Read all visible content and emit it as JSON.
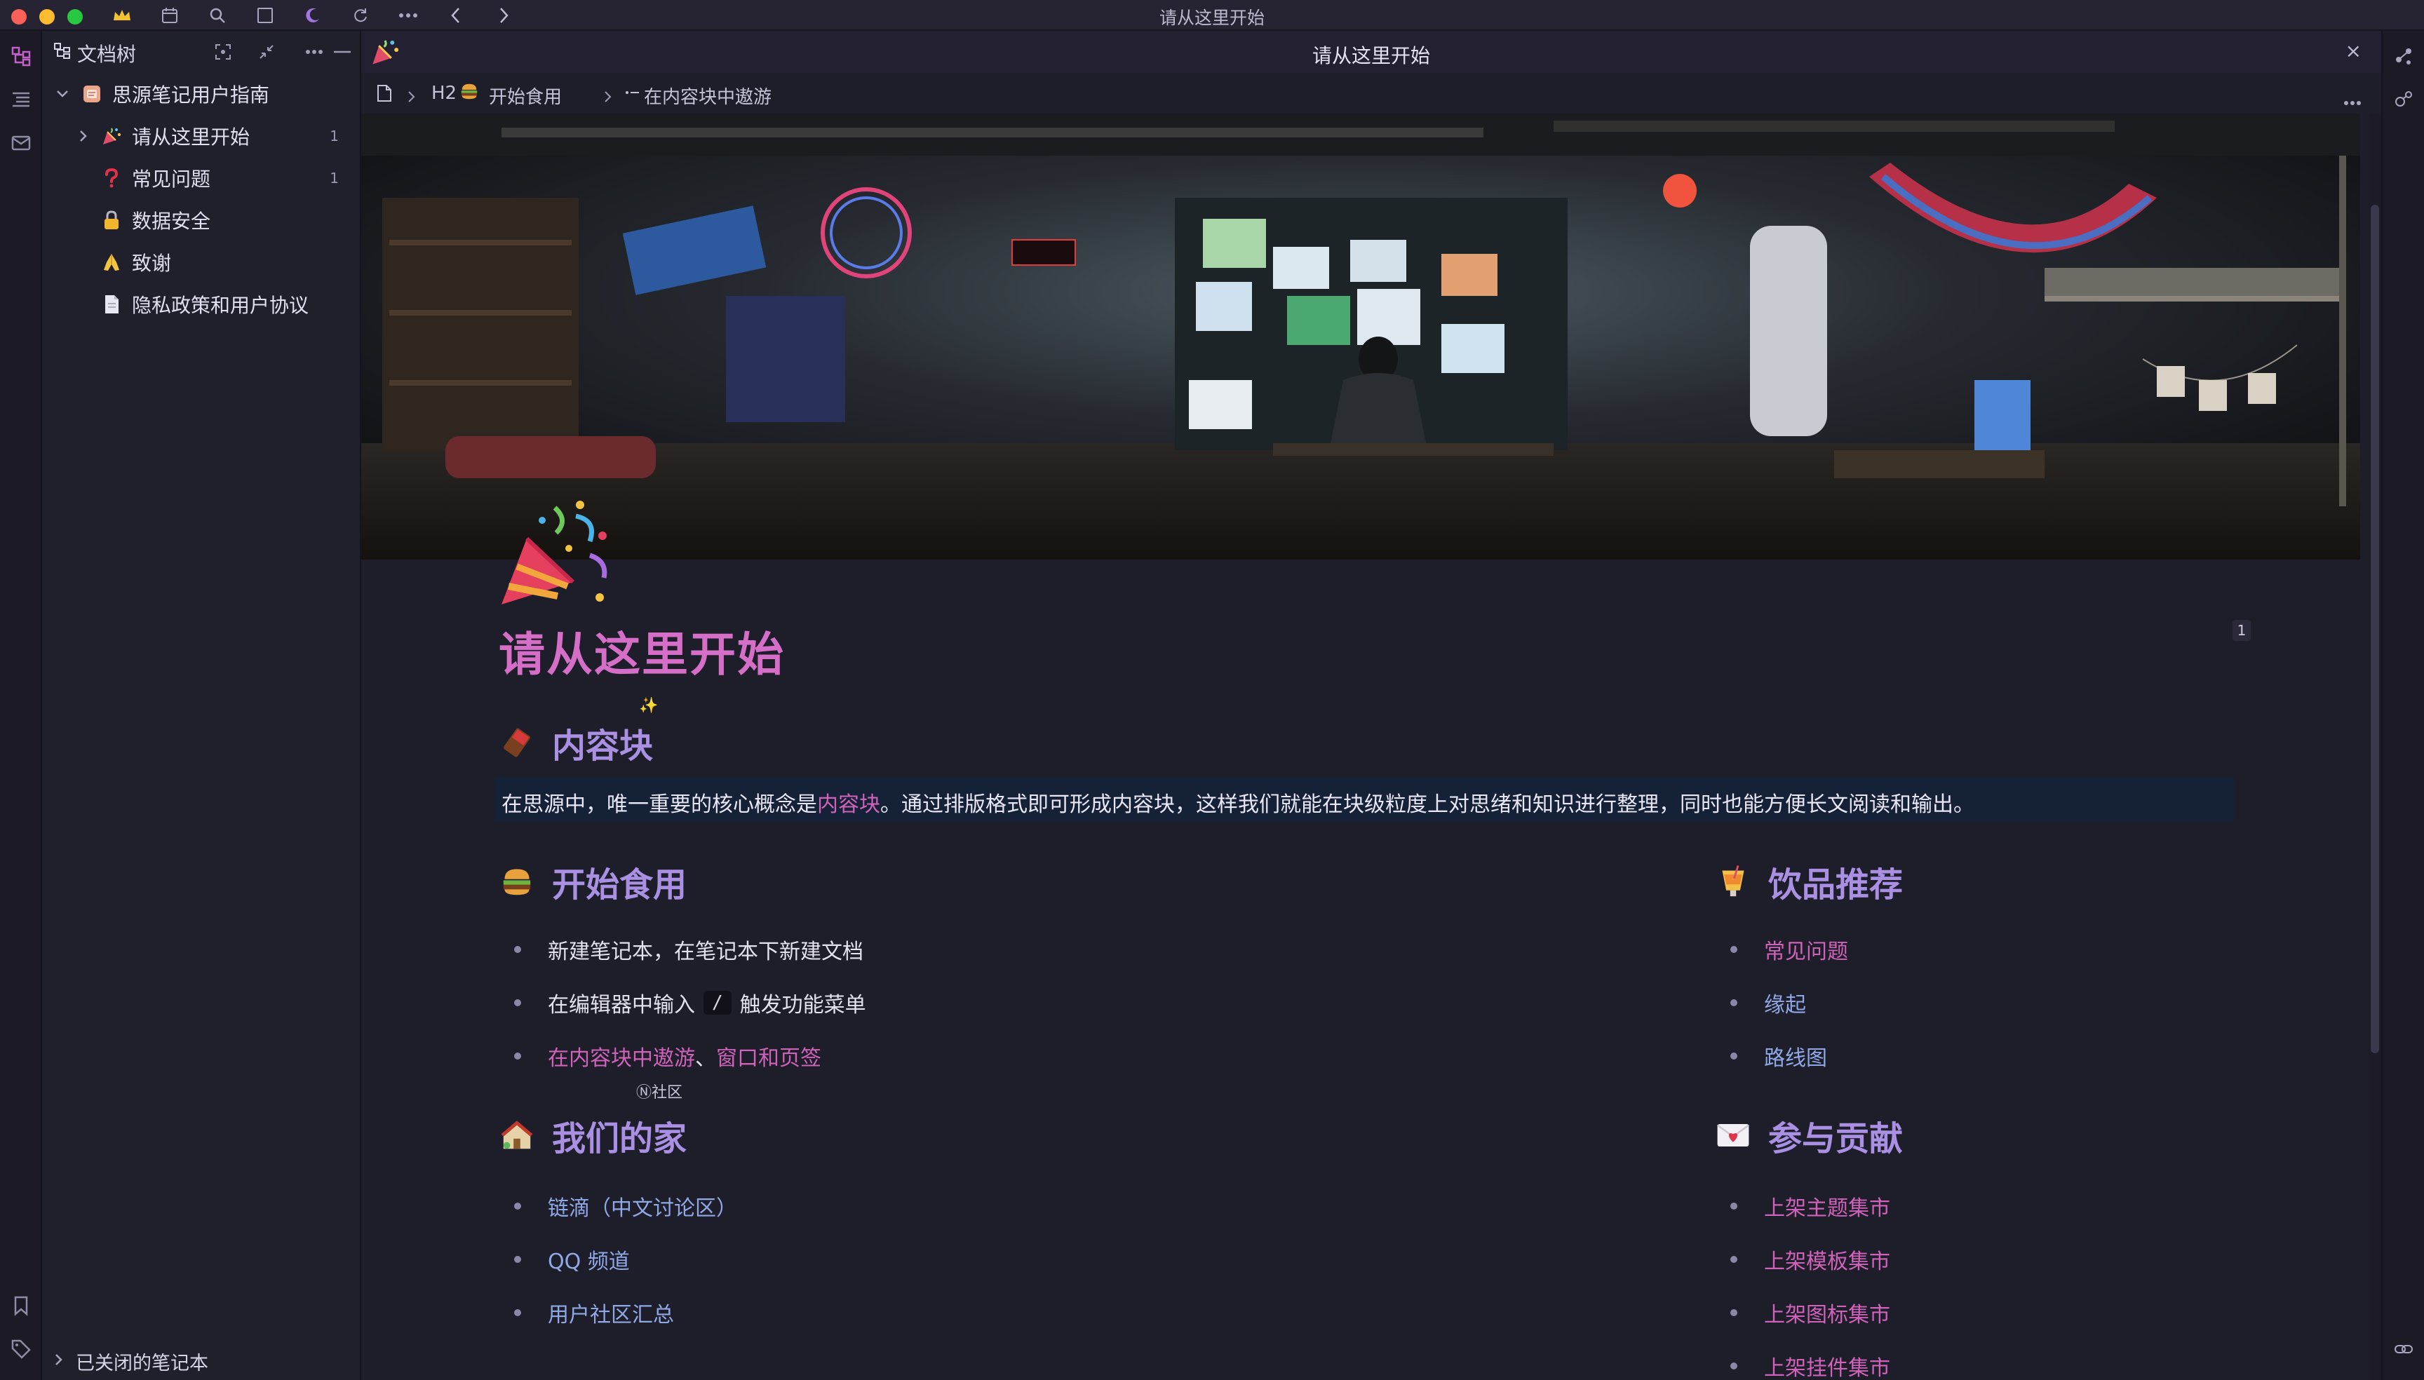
{
  "window": {
    "title": "请从这里开始"
  },
  "filetree": {
    "title": "文档树",
    "notebook": "思源笔记用户指南",
    "items": [
      {
        "label": "请从这里开始",
        "count": "1",
        "icon": "party-popper"
      },
      {
        "label": "常见问题",
        "count": "1",
        "icon": "question-mark"
      },
      {
        "label": "数据安全",
        "icon": "lock"
      },
      {
        "label": "致谢",
        "icon": "folded-hands"
      },
      {
        "label": "隐私政策和用户协议",
        "icon": "document"
      }
    ],
    "closed_notebooks": "已关闭的笔记本"
  },
  "editor": {
    "tab_title": "请从这里开始",
    "breadcrumb": {
      "h2_label": "H2",
      "section": "开始食用",
      "current": "在内容块中遨游"
    },
    "doc_title": "请从这里开始",
    "title_badge": "1",
    "sections": {
      "content_block": {
        "heading": "内容块",
        "para_before": "在思源中，唯一重要的核心概念是",
        "para_link": "内容块",
        "para_after": "。通过排版格式即可形成内容块，这样我们就能在块级粒度上对思绪和知识进行整理，同时也能方便长文阅读和输出。"
      },
      "getting_started": {
        "heading": "开始食用",
        "item1": "新建笔记本，在笔记本下新建文档",
        "item2_before": "在编辑器中输入",
        "item2_kbd": "/",
        "item2_after": "触发功能菜单",
        "item3_link1": "在内容块中遨游",
        "item3_sep": "、",
        "item3_link2": "窗口和页签"
      },
      "drinks": {
        "heading": "饮品推荐",
        "items": [
          "常见问题",
          "缘起",
          "路线图"
        ]
      },
      "home": {
        "heading": "我们的家",
        "tag": "Ⓝ社区",
        "items": [
          "链滴（中文讨论区）",
          "QQ 频道",
          "用户社区汇总"
        ]
      },
      "contribute": {
        "heading": "参与贡献",
        "items": [
          "上架主题集市",
          "上架模板集市",
          "上架图标集市",
          "上架挂件集市"
        ]
      }
    }
  },
  "colors": {
    "accent_pink": "#d46ec6",
    "heading_purple": "#a990e3",
    "link_blue": "#8fa8e6",
    "para_bg": "#152136"
  }
}
